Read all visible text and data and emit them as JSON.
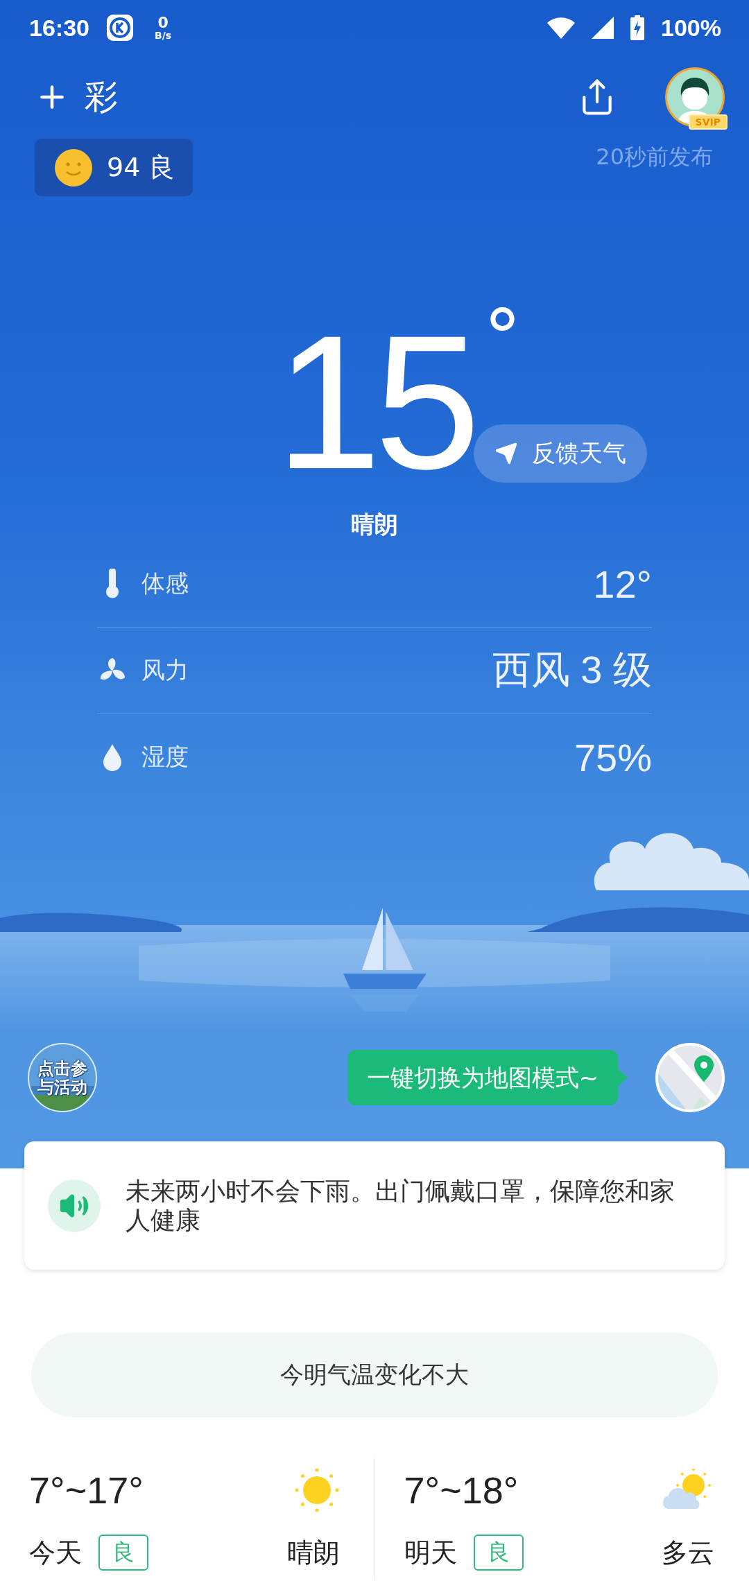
{
  "status_bar": {
    "time": "16:30",
    "net_speed_value": "0",
    "net_speed_unit": "B/s",
    "battery": "100%"
  },
  "header": {
    "city": "彩",
    "badge": "SVIP"
  },
  "aqi": {
    "value": "94",
    "level": "良"
  },
  "published": "20秒前发布",
  "current": {
    "temperature": "15",
    "unit": "°",
    "condition": "晴朗",
    "feedback_button": "反馈天气"
  },
  "details": [
    {
      "kind": "feels",
      "label": "体感",
      "value": "12°"
    },
    {
      "kind": "wind",
      "label": "风力",
      "value": "西风 3 级"
    },
    {
      "kind": "humidity",
      "label": "湿度",
      "value": "75%"
    }
  ],
  "activity_button": {
    "lines": [
      "点击参",
      "与活动"
    ]
  },
  "map_tip": "一键切换为地图模式~",
  "notice": "未来两小时不会下雨。出门佩戴口罩，保障您和家人健康",
  "summary": "今明气温变化不大",
  "forecast": [
    {
      "range": "7°~17°",
      "day": "今天",
      "aqi": "良",
      "condition": "晴朗",
      "kind": "sunny"
    },
    {
      "range": "7°~18°",
      "day": "明天",
      "aqi": "良",
      "condition": "多云",
      "kind": "cloudy"
    }
  ]
}
